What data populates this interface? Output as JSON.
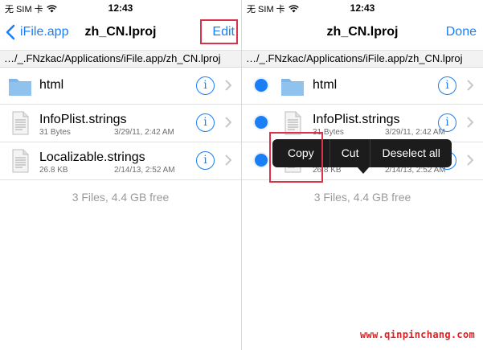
{
  "status": {
    "carrier": "无 SIM 卡",
    "time": "12:43"
  },
  "left": {
    "nav": {
      "back_label": "iFile.app",
      "title": "zh_CN.lproj",
      "action_label": "Edit"
    },
    "path": "…/_.FNzkac/Applications/iFile.app/zh_CN.lproj",
    "footer": "3 Files, 4.4 GB free"
  },
  "right": {
    "nav": {
      "title": "zh_CN.lproj",
      "action_label": "Done"
    },
    "path": "…/_.FNzkac/Applications/iFile.app/zh_CN.lproj",
    "footer": "3 Files, 4.4 GB free",
    "menu": {
      "copy": "Copy",
      "cut": "Cut",
      "deselect_all": "Deselect all"
    }
  },
  "files": [
    {
      "name": "html",
      "type": "folder",
      "icon": "folder-icon"
    },
    {
      "name": "InfoPlist.strings",
      "type": "file",
      "icon": "document-icon",
      "size": "31 Bytes",
      "date": "3/29/11, 2:42 AM"
    },
    {
      "name": "Localizable.strings",
      "type": "file",
      "icon": "document-icon",
      "size": "26.8 KB",
      "date": "2/14/13, 2:52 AM"
    }
  ],
  "watermark": "www.qinpinchang.com",
  "colors": {
    "accent": "#1a7ff6",
    "highlight_box": "#d9334a",
    "menu_bg": "#1c1c1c"
  }
}
